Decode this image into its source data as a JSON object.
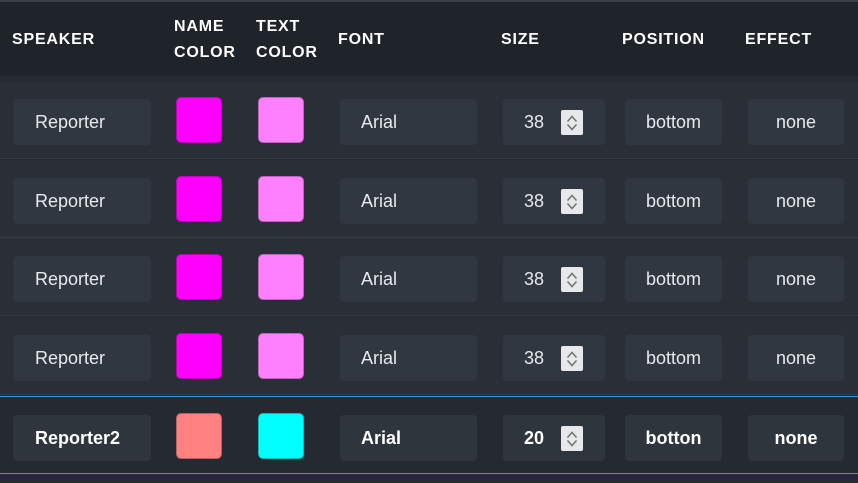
{
  "header": {
    "speaker": "SPEAKER",
    "name_color": "NAME\nCOLOR",
    "text_color": "TEXT\nCOLOR",
    "font": "FONT",
    "size": "SIZE",
    "position": "POSITION",
    "effect": "EFFECT"
  },
  "rows": [
    {
      "speaker": "Reporter",
      "name_color": "#ff00ff",
      "text_color": "#ff80ff",
      "font": "Arial",
      "size": "38",
      "position": "bottom",
      "effect": "none"
    },
    {
      "speaker": "Reporter",
      "name_color": "#ff00ff",
      "text_color": "#ff80ff",
      "font": "Arial",
      "size": "38",
      "position": "bottom",
      "effect": "none"
    },
    {
      "speaker": "Reporter",
      "name_color": "#ff00ff",
      "text_color": "#ff80ff",
      "font": "Arial",
      "size": "38",
      "position": "bottom",
      "effect": "none"
    },
    {
      "speaker": "Reporter",
      "name_color": "#ff00ff",
      "text_color": "#ff80ff",
      "font": "Arial",
      "size": "38",
      "position": "bottom",
      "effect": "none"
    },
    {
      "speaker": "Reporter2",
      "name_color": "#ff8080",
      "text_color": "#00ffff",
      "font": "Arial",
      "size": "20",
      "position": "botton",
      "effect": "none",
      "selected": true
    }
  ],
  "colors": {
    "selection_border": "#2e9bd6"
  }
}
